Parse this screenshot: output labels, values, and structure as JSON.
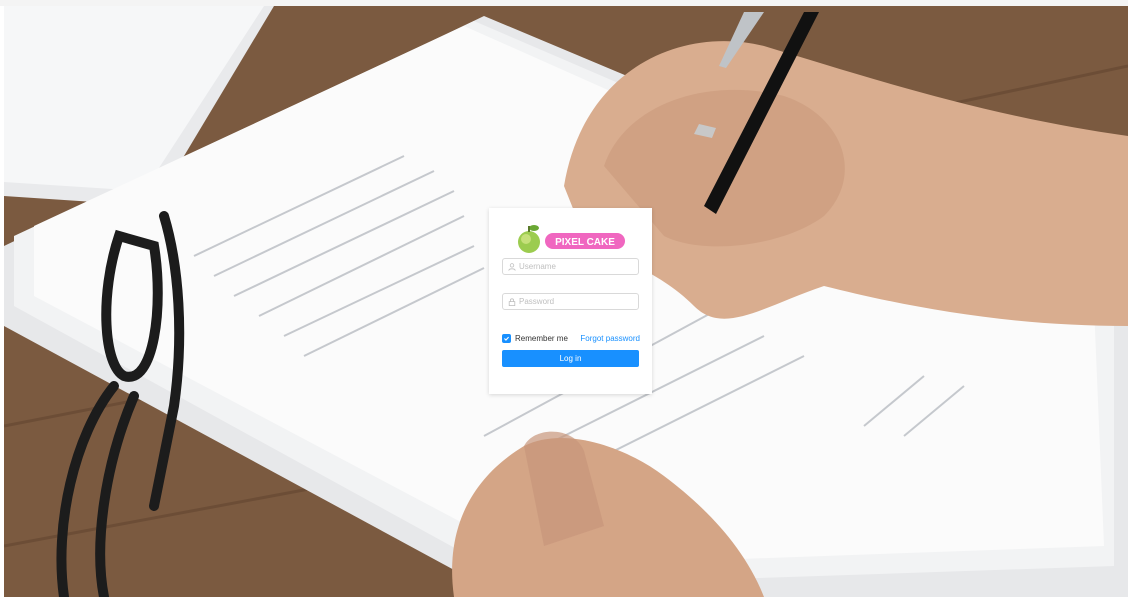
{
  "brand": {
    "logo_text": "PIXEL CAKE",
    "logo_color": "#f067c0",
    "apple_color": "#8ac43f"
  },
  "login": {
    "username_placeholder": "Username",
    "password_placeholder": "Password",
    "remember_label": "Remember me",
    "remember_checked": true,
    "forgot_label": "Forgot password",
    "submit_label": "Log in"
  },
  "icons": {
    "username": "user-icon",
    "password": "lock-icon",
    "checkbox": "check-icon"
  },
  "colors": {
    "primary": "#1890ff",
    "border": "#d9d9d9",
    "placeholder": "#bfbfbf"
  }
}
